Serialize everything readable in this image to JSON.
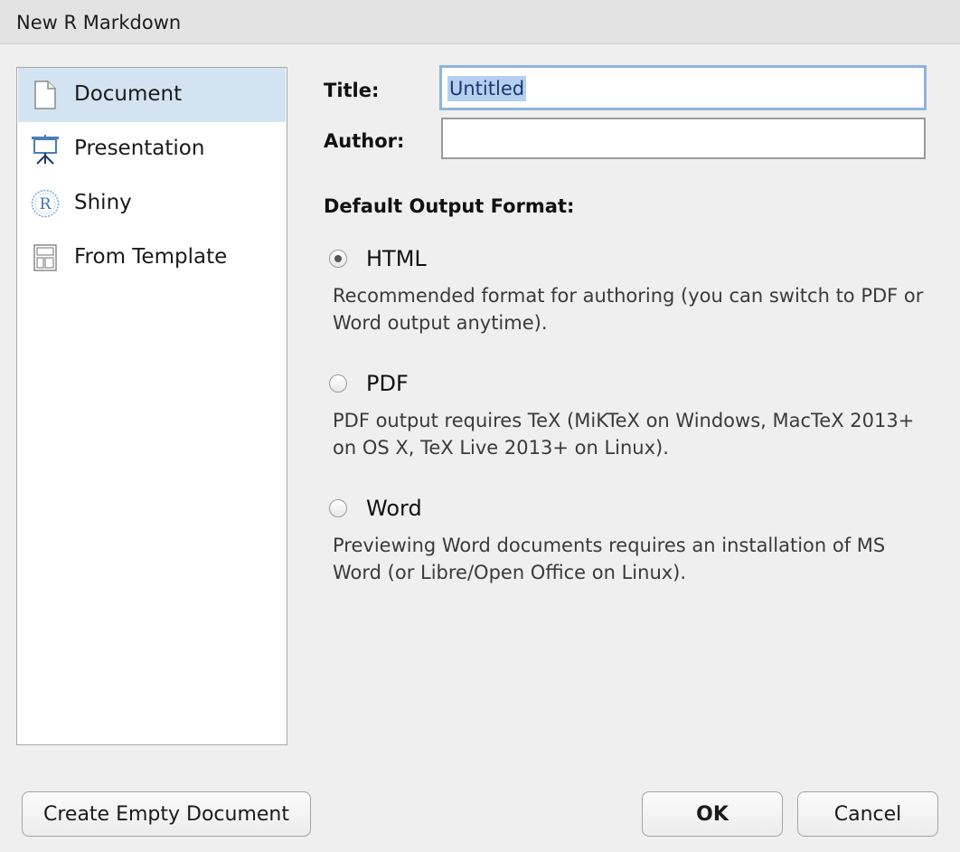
{
  "window": {
    "title": "New R Markdown"
  },
  "sidebar": {
    "items": [
      {
        "label": "Document",
        "icon": "document-icon",
        "selected": true
      },
      {
        "label": "Presentation",
        "icon": "presentation-icon",
        "selected": false
      },
      {
        "label": "Shiny",
        "icon": "shiny-r-icon",
        "selected": false
      },
      {
        "label": "From Template",
        "icon": "template-icon",
        "selected": false
      }
    ]
  },
  "form": {
    "title_label": "Title:",
    "title_value": "Untitled",
    "author_label": "Author:",
    "author_value": ""
  },
  "output": {
    "heading": "Default Output Format:",
    "options": [
      {
        "label": "HTML",
        "checked": true,
        "description": "Recommended format for authoring (you can switch to PDF or Word output anytime)."
      },
      {
        "label": "PDF",
        "checked": false,
        "description": "PDF output requires TeX (MiKTeX on Windows, MacTeX 2013+ on OS X, TeX Live 2013+ on Linux)."
      },
      {
        "label": "Word",
        "checked": false,
        "description": "Previewing Word documents requires an installation of MS Word (or Libre/Open Office on Linux)."
      }
    ]
  },
  "buttons": {
    "create_empty": "Create Empty Document",
    "ok": "OK",
    "cancel": "Cancel"
  },
  "colors": {
    "selection": "#d4e3f1",
    "focus_ring": "#8fb3dd",
    "text_selection": "#b4cff0",
    "icon_blue": "#4a7fb5"
  }
}
